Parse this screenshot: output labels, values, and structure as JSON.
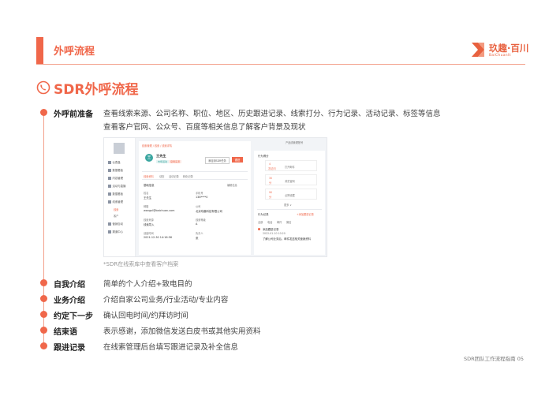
{
  "header": {
    "title": "外呼流程",
    "logo_cn": "玖趣·百川",
    "logo_en": "BaiChuanIt"
  },
  "section": {
    "title": "SDR外呼流程"
  },
  "steps": [
    {
      "label": "外呼前准备",
      "lines": [
        "查看线索来源、公司名称、职位、地区、历史跟进记录、线索打分、行为记录、活动记录、标签等信息",
        "查看客户官网、公众号、百度等相关信息了解客户背景及现状"
      ]
    },
    {
      "label": "自我介绍",
      "lines": [
        "简单的个人介绍+致电目的"
      ]
    },
    {
      "label": "业务介绍",
      "lines": [
        "介绍自家公司业务/行业活动/专业内容"
      ]
    },
    {
      "label": "约定下一步",
      "lines": [
        "确认回电时间/约拜访时间"
      ]
    },
    {
      "label": "结束语",
      "lines": [
        "表示感谢，添加微信发送白皮书或其他实用资料"
      ]
    },
    {
      "label": "跟进记录",
      "lines": [
        "在线索管理后台填写跟进记录及补全信息"
      ]
    }
  ],
  "screenshot": {
    "caption": "*SDR在线索库中查看客户档案",
    "sidebar": [
      "仪表盘",
      "数据看板",
      "内容管理",
      "活动与直播",
      "数据看板",
      "线索管理",
      "营销自动",
      "渠道中心"
    ],
    "sidebar_sub": [
      "线索",
      "客户"
    ],
    "breadcrumb": "线索管理 / 线索 / 线索详情",
    "top_right": "产品线管理账号",
    "name": "王先生",
    "avatar_char": "王",
    "tags": [
      "市场活动",
      "官网来源"
    ],
    "btn_outline": "添加到SDR任务",
    "btn_fill": "跟进",
    "tabs": [
      "线索资料",
      "动态",
      "活动记录",
      "转化记录"
    ],
    "sub_heading": "基础信息",
    "edit_label": "编辑信息",
    "fields": [
      {
        "k": "姓名",
        "v": "王先生"
      },
      {
        "k": "手机号",
        "v": "138****0"
      },
      {
        "k": "邮箱",
        "v": "wangxl@baichuan.com"
      },
      {
        "k": "公司",
        "v": "北京玖趣科技有限公司"
      },
      {
        "k": "线索来源",
        "v": "线索导入"
      },
      {
        "k": "线索等级",
        "v": "A"
      },
      {
        "k": "创建时间",
        "v": "2021-12-30 14:16:56"
      },
      {
        "k": "负责人",
        "v": "张"
      }
    ],
    "right_title": "行为得分",
    "right_cards": [
      {
        "score": "4",
        "unit": "次访问",
        "text": "打开邮件"
      },
      {
        "score": "30",
        "unit": "分",
        "text": "浏览官网"
      },
      {
        "score": "90",
        "unit": "分",
        "text": "点赞收藏"
      }
    ],
    "more": "更多 ∨",
    "follow_title": "行为记录",
    "follow_action": "+添加跟进记录",
    "follow_filters": [
      "全部",
      "电话",
      "邮件",
      "微信"
    ],
    "follow_entry_title": "添加跟进记录",
    "follow_entry_time": "2022-01-10 10:20",
    "follow_entry_text": "了解公司业务后，邮件发送相关营销资料"
  },
  "footer": "SDR团队工作流程指南  05",
  "colors": {
    "accent": "#f0674a",
    "accent_light": "#f3a18c"
  }
}
